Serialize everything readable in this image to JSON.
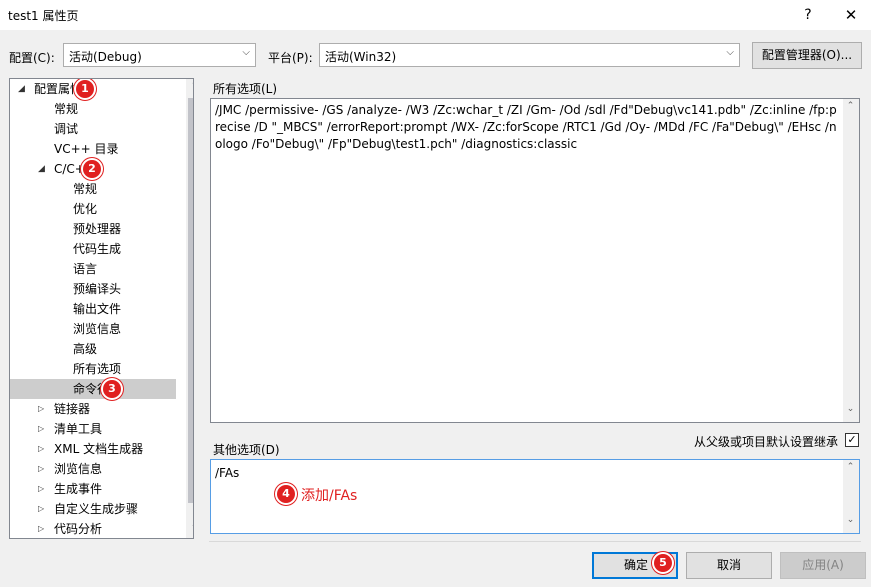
{
  "window": {
    "title": "test1 属性页",
    "help": "?",
    "close": "✕"
  },
  "config": {
    "label": "配置(C):",
    "value": "活动(Debug)"
  },
  "platform": {
    "label": "平台(P):",
    "value": "活动(Win32)"
  },
  "config_manager_label": "配置管理器(O)...",
  "tree": [
    {
      "label": "配置属性",
      "level": 0,
      "twisty": "expanded",
      "badge": "1"
    },
    {
      "label": "常规",
      "level": 1
    },
    {
      "label": "调试",
      "level": 1
    },
    {
      "label": "VC++ 目录",
      "level": 1
    },
    {
      "label": "C/C++",
      "level": 1,
      "twisty": "expanded",
      "badge": "2"
    },
    {
      "label": "常规",
      "level": 2
    },
    {
      "label": "优化",
      "level": 2
    },
    {
      "label": "预处理器",
      "level": 2
    },
    {
      "label": "代码生成",
      "level": 2
    },
    {
      "label": "语言",
      "level": 2
    },
    {
      "label": "预编译头",
      "level": 2
    },
    {
      "label": "输出文件",
      "level": 2
    },
    {
      "label": "浏览信息",
      "level": 2
    },
    {
      "label": "高级",
      "level": 2
    },
    {
      "label": "所有选项",
      "level": 2
    },
    {
      "label": "命令行",
      "level": 2,
      "selected": true,
      "badge": "3"
    },
    {
      "label": "链接器",
      "level": 1,
      "twisty": "collapsed"
    },
    {
      "label": "清单工具",
      "level": 1,
      "twisty": "collapsed"
    },
    {
      "label": "XML 文档生成器",
      "level": 1,
      "twisty": "collapsed"
    },
    {
      "label": "浏览信息",
      "level": 1,
      "twisty": "collapsed"
    },
    {
      "label": "生成事件",
      "level": 1,
      "twisty": "collapsed"
    },
    {
      "label": "自定义生成步骤",
      "level": 1,
      "twisty": "collapsed"
    },
    {
      "label": "代码分析",
      "level": 1,
      "twisty": "collapsed"
    }
  ],
  "all_options": {
    "label": "所有选项(L)",
    "text": "/JMC /permissive- /GS /analyze- /W3 /Zc:wchar_t /ZI /Gm- /Od /sdl /Fd\"Debug\\vc141.pdb\" /Zc:inline /fp:precise /D \"_MBCS\" /errorReport:prompt /WX- /Zc:forScope /RTC1 /Gd /Oy- /MDd /FC /Fa\"Debug\\\" /EHsc /nologo /Fo\"Debug\\\" /Fp\"Debug\\test1.pch\" /diagnostics:classic"
  },
  "other_options": {
    "label": "其他选项(D)",
    "value": "/FAs",
    "inherit_label": "从父级或项目默认设置继承",
    "inherit_checked": true,
    "check_mark": "✓"
  },
  "annotation": {
    "badge": "4",
    "text": "添加/FAs"
  },
  "buttons": {
    "ok": "确定",
    "ok_badge": "5",
    "cancel": "取消",
    "apply": "应用(A)"
  },
  "colors": {
    "badge": "#e02020",
    "annotation_text": "#e02020",
    "focus_border": "#0078d7"
  },
  "scroll": {
    "up": "▲",
    "down": "▼",
    "up_small": "⌃",
    "down_small": "⌄"
  }
}
